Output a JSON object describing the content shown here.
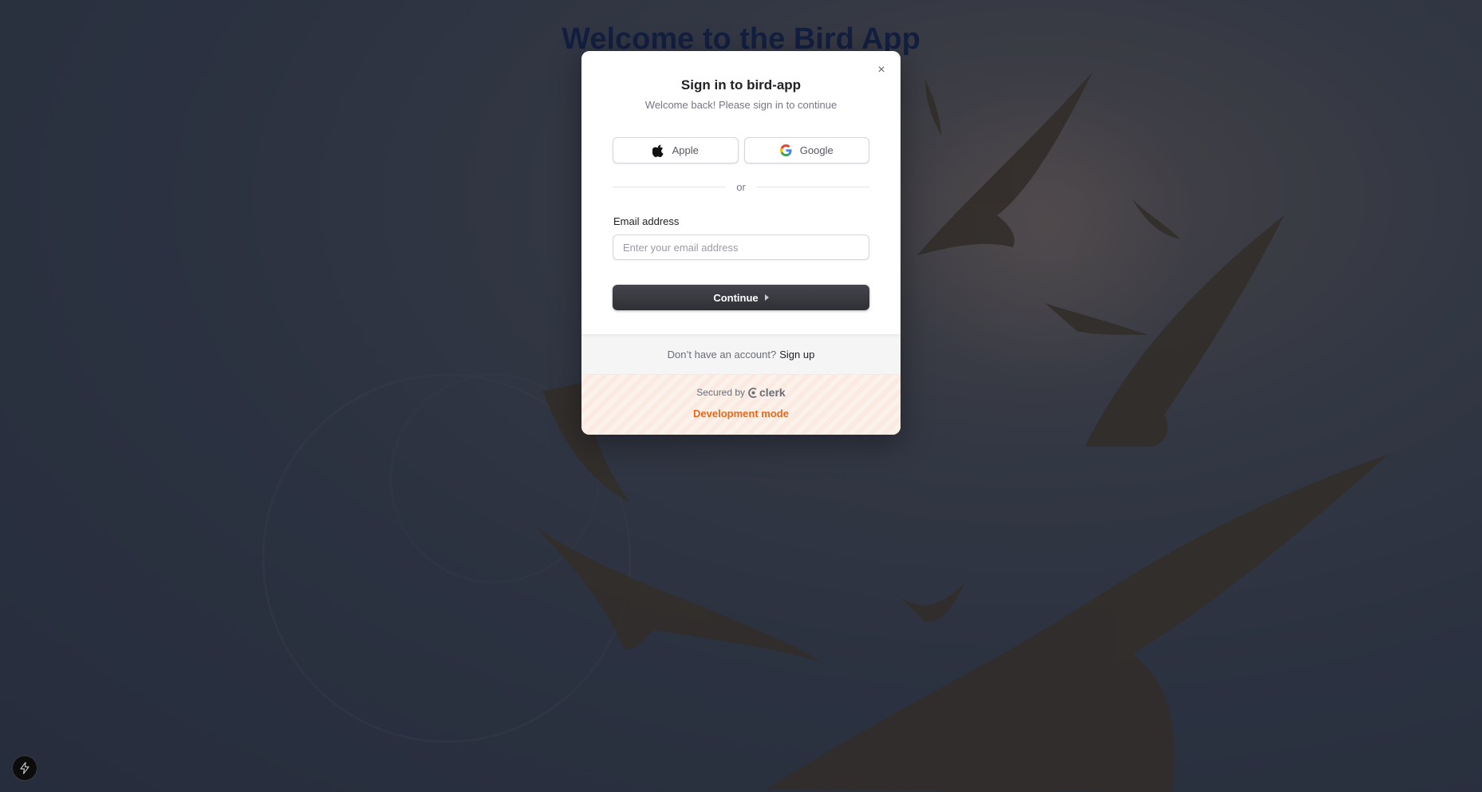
{
  "page": {
    "title": "Welcome to the Bird App"
  },
  "modal": {
    "close_symbol": "×",
    "title": "Sign in to bird-app",
    "subtitle": "Welcome back! Please sign in to continue",
    "social": [
      {
        "label": "Apple",
        "icon": "apple-icon"
      },
      {
        "label": "Google",
        "icon": "google-icon"
      }
    ],
    "divider_text": "or",
    "email": {
      "label": "Email address",
      "placeholder": "Enter your email address",
      "value": ""
    },
    "continue_label": "Continue",
    "signup": {
      "prompt": "Don’t have an account?",
      "link": "Sign up"
    },
    "footer": {
      "secured_by": "Secured by",
      "brand": "clerk",
      "mode": "Development mode"
    }
  },
  "colors": {
    "title": "#0f1e4a",
    "primary_button": "#2f3035",
    "dev_mode": "#e8671b"
  },
  "dev_badge": {
    "icon": "lightning-icon"
  }
}
